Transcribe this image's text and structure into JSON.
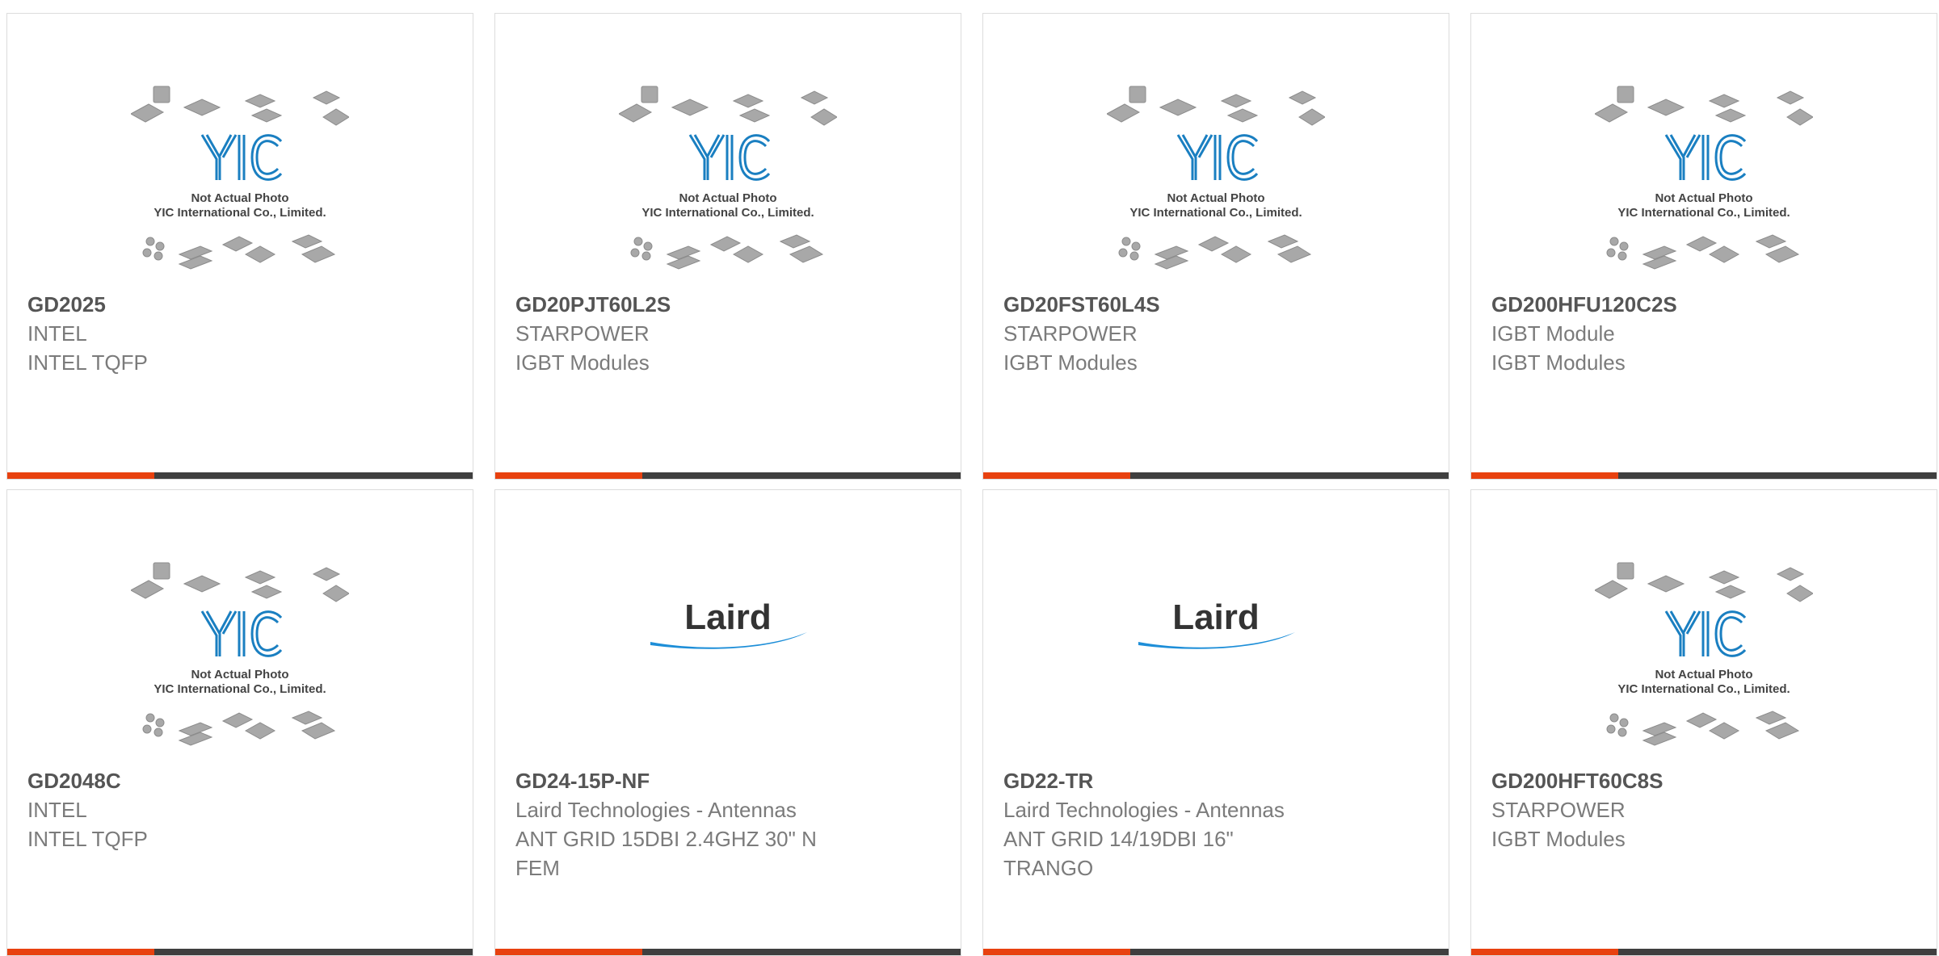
{
  "placeholder": {
    "line1": "Not Actual Photo",
    "line2": "YIC International Co., Limited.",
    "logo_text": "YIC"
  },
  "laird_logo": "Laird",
  "colors": {
    "accent": "#e8410f",
    "bar": "#3f3f3f",
    "yic_blue": "#1a7fc1",
    "laird_blue": "#1d8ed8"
  },
  "products": [
    {
      "part": "GD2025",
      "manufacturer": "INTEL",
      "description": "INTEL TQFP",
      "image": "yic-placeholder"
    },
    {
      "part": "GD20PJT60L2S",
      "manufacturer": "STARPOWER",
      "description": "IGBT Modules",
      "image": "yic-placeholder"
    },
    {
      "part": "GD20FST60L4S",
      "manufacturer": "STARPOWER",
      "description": "IGBT Modules",
      "image": "yic-placeholder"
    },
    {
      "part": "GD200HFU120C2S",
      "manufacturer": "IGBT Module",
      "description": "IGBT Modules",
      "image": "yic-placeholder"
    },
    {
      "part": "GD2048C",
      "manufacturer": "INTEL",
      "description": "INTEL TQFP",
      "image": "yic-placeholder"
    },
    {
      "part": "GD24-15P-NF",
      "manufacturer": "Laird Technologies - Antennas",
      "description": "ANT GRID 15DBI 2.4GHZ 30\" N",
      "description2": "FEM",
      "image": "laird-logo"
    },
    {
      "part": "GD22-TR",
      "manufacturer": "Laird Technologies - Antennas",
      "description": "ANT GRID 14/19DBI 16\"",
      "description2": "TRANGO",
      "image": "laird-logo"
    },
    {
      "part": "GD200HFT60C8S",
      "manufacturer": "STARPOWER",
      "description": "IGBT Modules",
      "image": "yic-placeholder"
    }
  ]
}
